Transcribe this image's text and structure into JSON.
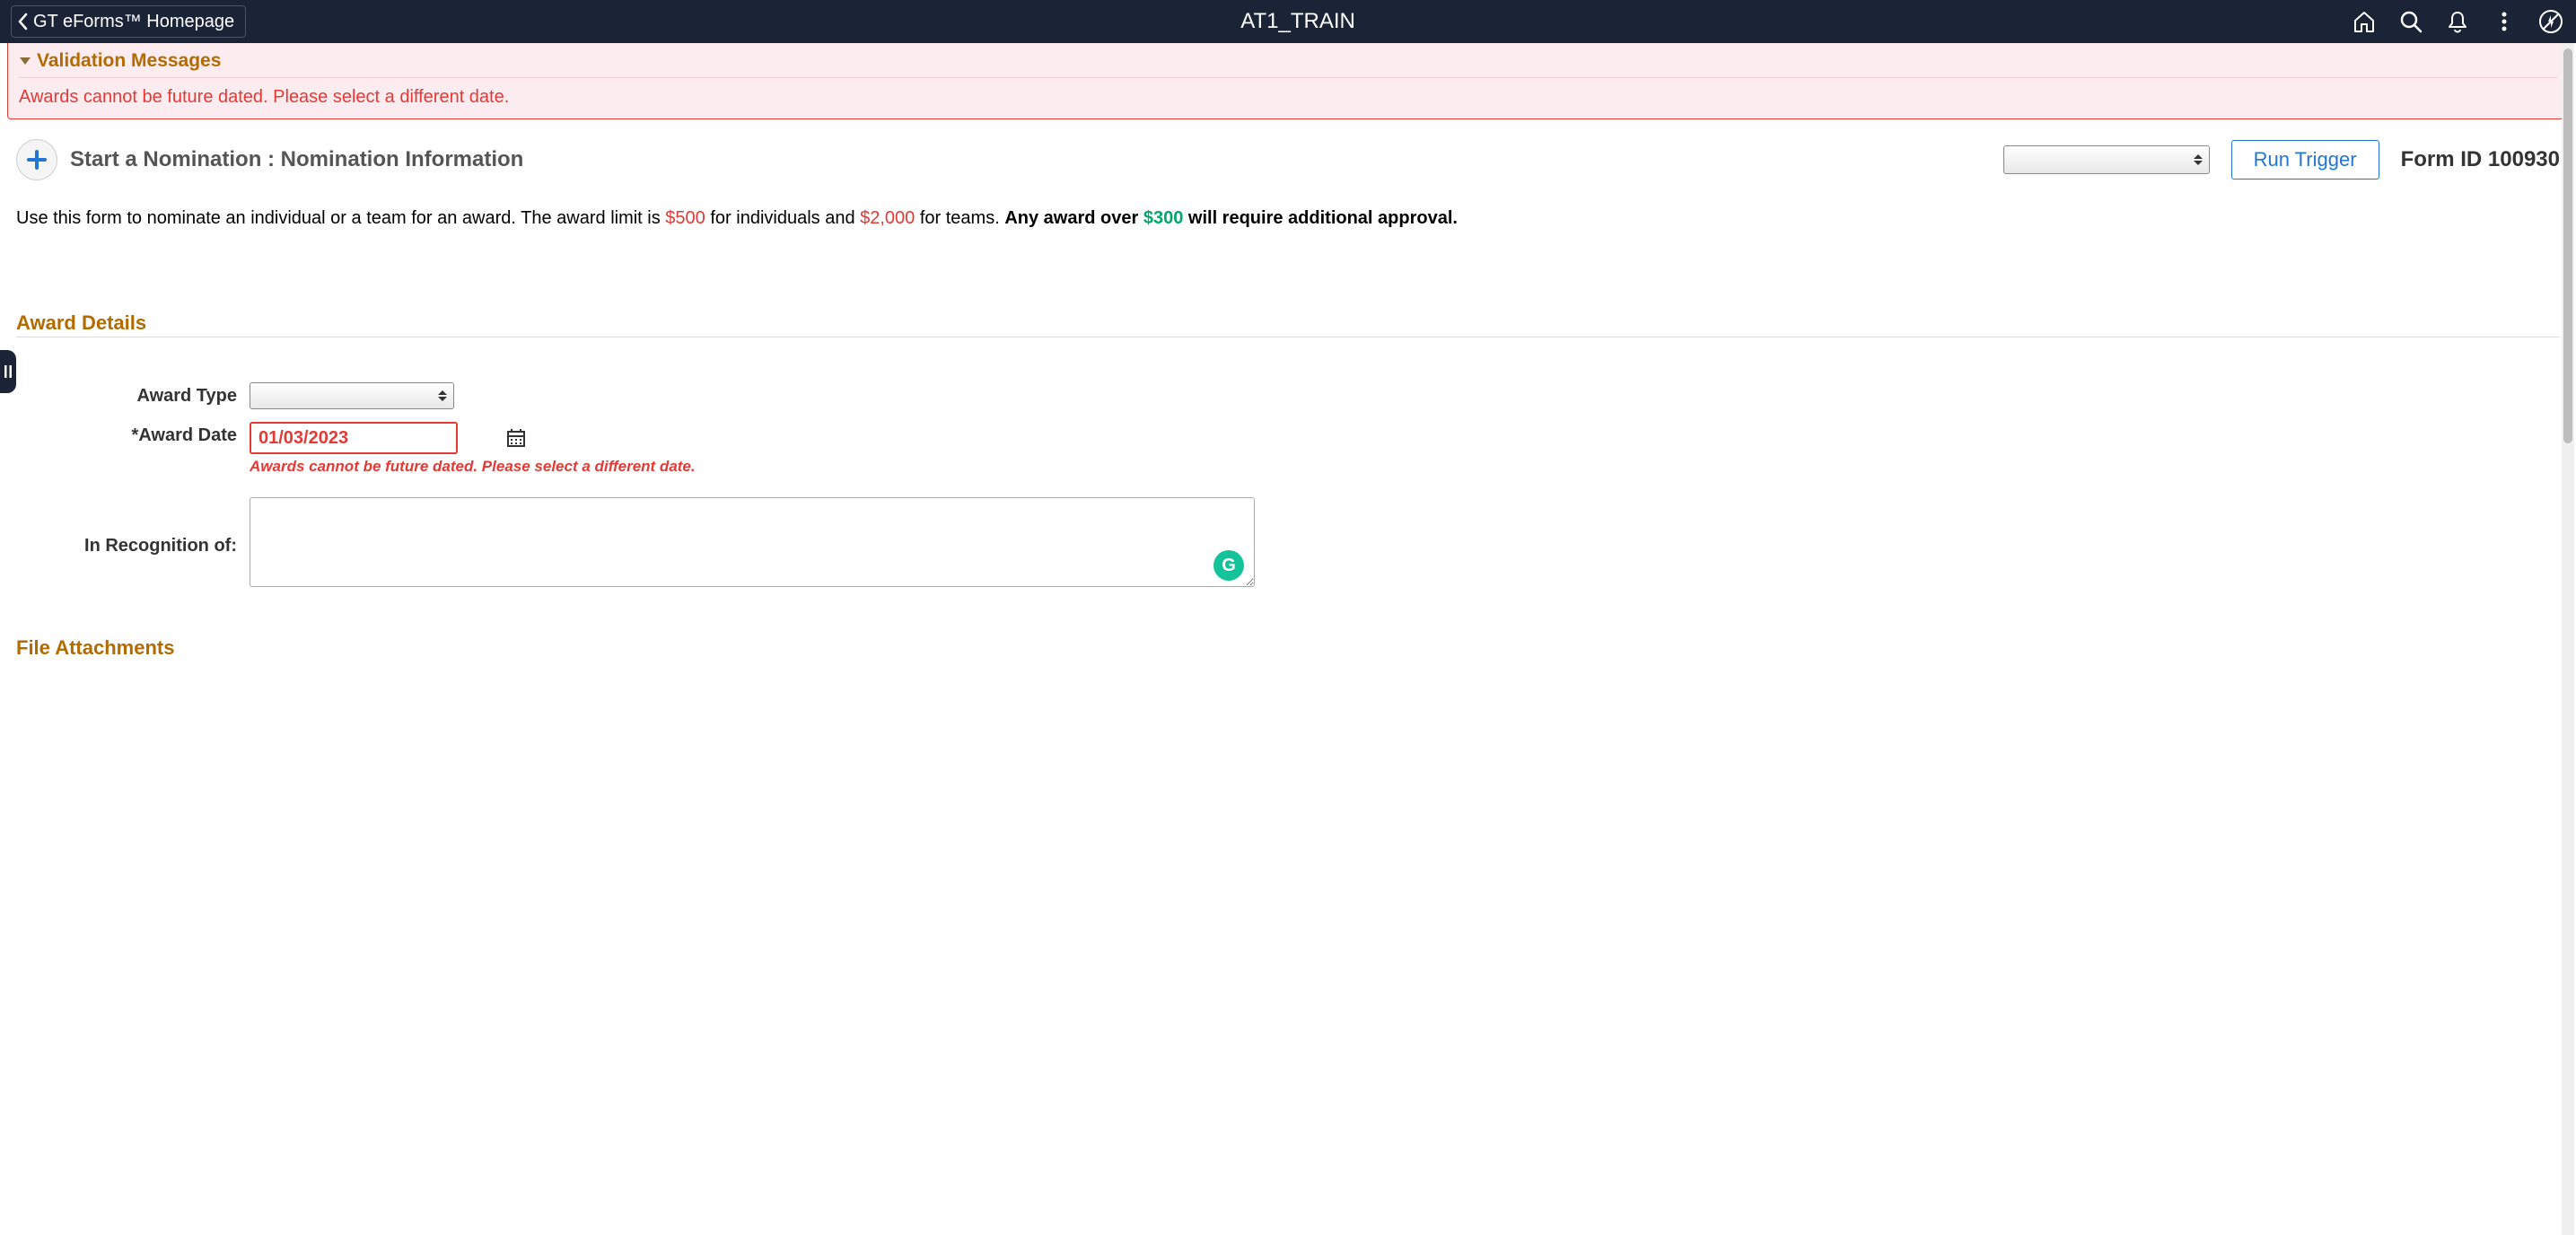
{
  "header": {
    "back_label": "GT eForms™ Homepage",
    "title": "AT1_TRAIN"
  },
  "validation": {
    "title": "Validation Messages",
    "message": "Awards cannot be future dated. Please select a different date."
  },
  "form_header": {
    "title": "Start a Nomination :  Nomination Information",
    "run_trigger_label": "Run Trigger",
    "form_id_label": "Form ID",
    "form_id_value": "100930"
  },
  "intro": {
    "part1": "Use this form to nominate an individual or a team for an award. The award limit is ",
    "amount1": "$500",
    "part2": " for individuals and ",
    "amount2": "$2,000",
    "part3": " for teams. ",
    "bold1": "Any award over ",
    "amount3": "$300",
    "bold2": " will require additional approval."
  },
  "sections": {
    "award_details": "Award Details",
    "file_attachments": "File Attachments"
  },
  "fields": {
    "award_type_label": "Award Type",
    "award_date_label": "*Award Date",
    "award_date_value": "01/03/2023",
    "award_date_error": "Awards cannot be future dated. Please select a different date.",
    "recognition_label": "In Recognition of:"
  },
  "grammarly": "G"
}
